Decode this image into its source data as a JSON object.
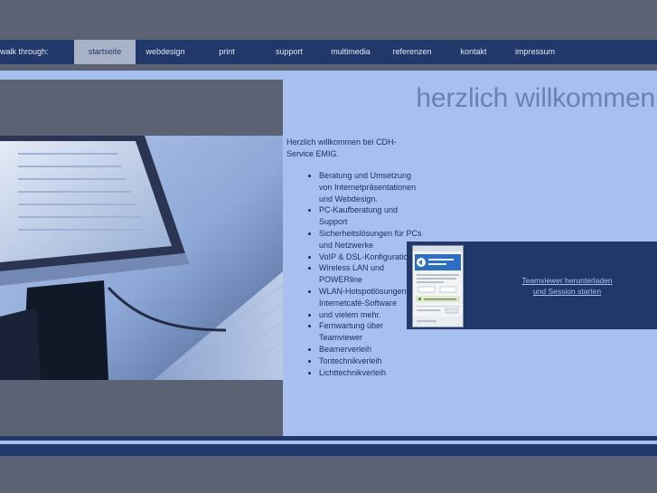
{
  "nav": {
    "label": "walk through:",
    "items": [
      {
        "label": "startseite",
        "active": true
      },
      {
        "label": "webdesign"
      },
      {
        "label": "print"
      },
      {
        "label": "support"
      },
      {
        "label": "multimedia"
      },
      {
        "label": "referenzen"
      },
      {
        "label": "kontakt"
      },
      {
        "label": "impressum"
      }
    ]
  },
  "main": {
    "title": "herzlich willkommen",
    "intro": "Herzlich willkommen bei CDH-Service EMIG.",
    "features": [
      "Beratung und Umsetzung von Internetpräsentationen und Webdesign.",
      "PC-Kaufberatung und Support",
      "Sicherheitslösungen für PCs und Netzwerke",
      "VoIP & DSL-Konfiguration",
      "Wireless LAN und POWERline",
      "WLAN-Hotspotlösungen und Internetcafé-Software",
      "und vielem mehr.",
      "Fernwartung über Teamviewer",
      "Beamerverleih",
      "Tontechnikverleih",
      "Lichttechnikverleih"
    ]
  },
  "teamviewer": {
    "link_line1": "Teamviewer herunterladen",
    "link_line2": "und Session starten"
  },
  "colors": {
    "background": "#5b6274",
    "nav": "#22386b",
    "content": "#a8c0f0",
    "title": "#6a81b5"
  }
}
